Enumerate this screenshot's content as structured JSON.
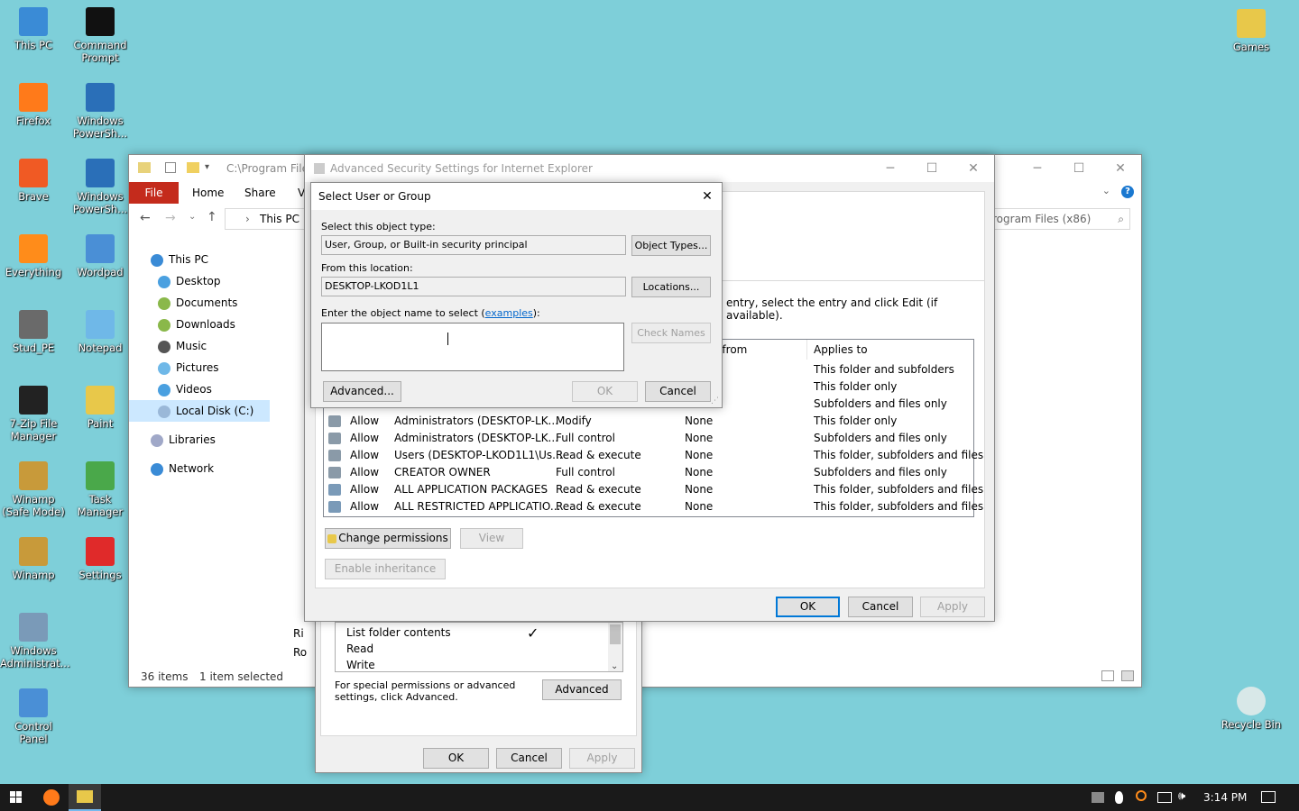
{
  "desktop": {
    "icons_left": [
      {
        "label": "This PC",
        "color": "#3a8bd6"
      },
      {
        "label": "Command Prompt",
        "color": "#111111"
      },
      {
        "label": "Firefox",
        "color": "#ff7a1a"
      },
      {
        "label": "Windows PowerSh...",
        "color": "#2a6fb8"
      },
      {
        "label": "Brave",
        "color": "#f05a24"
      },
      {
        "label": "Windows PowerSh...",
        "color": "#2a6fb8"
      },
      {
        "label": "Everything",
        "color": "#ff8c1a"
      },
      {
        "label": "Wordpad",
        "color": "#4a8fd6"
      },
      {
        "label": "Stud_PE",
        "color": "#6a6a6a"
      },
      {
        "label": "Notepad",
        "color": "#6fb8e8"
      },
      {
        "label": "7-Zip File Manager",
        "color": "#222222"
      },
      {
        "label": "Paint",
        "color": "#e8c84a"
      },
      {
        "label": "Winamp (Safe Mode)",
        "color": "#c89a3a"
      },
      {
        "label": "Task Manager",
        "color": "#4aa84a"
      },
      {
        "label": "Winamp",
        "color": "#c89a3a"
      },
      {
        "label": "Settings",
        "color": "#e02a2a"
      },
      {
        "label": "Windows Administrat...",
        "color": "#7a9ab8"
      },
      {
        "label": "Control Panel",
        "color": "#4a8fd6"
      }
    ],
    "games_label": "Games",
    "recycle_label": "Recycle Bin"
  },
  "explorer": {
    "path": "C:\\Program Files",
    "tabs": {
      "file": "File",
      "home": "Home",
      "share": "Share",
      "view": "V"
    },
    "breadcrumb": "This PC",
    "search_path": "rogram Files (x86)",
    "nav": [
      {
        "label": "This PC",
        "color": "#3a8bd6"
      },
      {
        "label": "Desktop",
        "color": "#4aa0e0"
      },
      {
        "label": "Documents",
        "color": "#8ab84a"
      },
      {
        "label": "Downloads",
        "color": "#8ab84a"
      },
      {
        "label": "Music",
        "color": "#555555"
      },
      {
        "label": "Pictures",
        "color": "#6fb8e8"
      },
      {
        "label": "Videos",
        "color": "#4aa0e0"
      },
      {
        "label": "Local Disk (C:)",
        "color": "#9ab8d8"
      },
      {
        "label": "Libraries",
        "color": "#a0a8c8"
      },
      {
        "label": "Network",
        "color": "#3a8bd6"
      }
    ],
    "items_count": "36 items",
    "selected": "1 item selected",
    "partial_rows": {
      "a": "Ri",
      "b": "Ro"
    }
  },
  "advanced": {
    "title": "Advanced Security Settings for Internet Explorer",
    "instruction": "entry, select the entry and click Edit (if available).",
    "col_inherited": "d from",
    "col_applies": "Applies to",
    "top_rows": [
      "This folder and subfolders",
      "This folder only",
      "Subfolders and files only"
    ],
    "rows": [
      {
        "type": "Allow",
        "principal": "Administrators (DESKTOP-LK...",
        "access": "Modify",
        "inherited": "None",
        "applies": "This folder only"
      },
      {
        "type": "Allow",
        "principal": "Administrators (DESKTOP-LK...",
        "access": "Full control",
        "inherited": "None",
        "applies": "Subfolders and files only"
      },
      {
        "type": "Allow",
        "principal": "Users (DESKTOP-LKOD1L1\\Us...",
        "access": "Read & execute",
        "inherited": "None",
        "applies": "This folder, subfolders and files"
      },
      {
        "type": "Allow",
        "principal": "CREATOR OWNER",
        "access": "Full control",
        "inherited": "None",
        "applies": "Subfolders and files only"
      },
      {
        "type": "Allow",
        "principal": "ALL APPLICATION PACKAGES",
        "access": "Read & execute",
        "inherited": "None",
        "applies": "This folder, subfolders and files"
      },
      {
        "type": "Allow",
        "principal": "ALL RESTRICTED APPLICATIO...",
        "access": "Read & execute",
        "inherited": "None",
        "applies": "This folder, subfolders and files"
      }
    ],
    "change_permissions": "Change permissions",
    "view": "View",
    "enable_inheritance": "Enable inheritance",
    "ok": "OK",
    "cancel": "Cancel",
    "apply": "Apply"
  },
  "properties": {
    "perm_items": [
      "List folder contents",
      "Read",
      "Write"
    ],
    "check": "✓",
    "special_text": "For special permissions or advanced settings, click Advanced.",
    "advanced": "Advanced",
    "ok": "OK",
    "cancel": "Cancel",
    "apply": "Apply"
  },
  "select_dialog": {
    "title": "Select User or Group",
    "object_type_label": "Select this object type:",
    "object_type_value": "User, Group, or Built-in security principal",
    "object_types_btn": "Object Types...",
    "location_label": "From this location:",
    "location_value": "DESKTOP-LKOD1L1",
    "locations_btn": "Locations...",
    "enter_label": "Enter the object name to select (",
    "examples": "examples",
    "enter_label_end": "):",
    "check_names": "Check Names",
    "advanced": "Advanced...",
    "ok": "OK",
    "cancel": "Cancel",
    "close": "✕"
  },
  "taskbar": {
    "time": "3:14 PM"
  }
}
